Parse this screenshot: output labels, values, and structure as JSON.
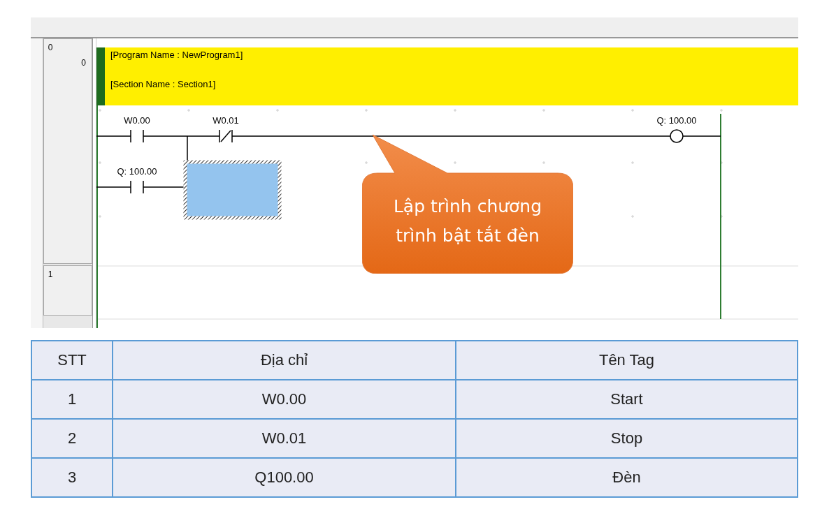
{
  "editor": {
    "rungs": [
      {
        "number": "0",
        "step": "0"
      },
      {
        "number": "1"
      }
    ],
    "header": {
      "program_name": "[Program Name : NewProgram1]",
      "section_name": "[Section Name : Section1]"
    },
    "contacts": [
      {
        "kind": "no",
        "label": "W0.00"
      },
      {
        "kind": "nc",
        "label": "W0.01"
      },
      {
        "kind": "no",
        "label": "Q: 100.00"
      }
    ],
    "coil": {
      "label": "Q: 100.00"
    },
    "callout": "Lập trình chương trình bật tắt đèn"
  },
  "table": {
    "columns": [
      "STT",
      "Địa chỉ",
      "Tên Tag"
    ],
    "rows": [
      [
        "1",
        "W0.00",
        "Start"
      ],
      [
        "2",
        "W0.01",
        "Stop"
      ],
      [
        "3",
        "Q100.00",
        "Đèn"
      ]
    ]
  }
}
